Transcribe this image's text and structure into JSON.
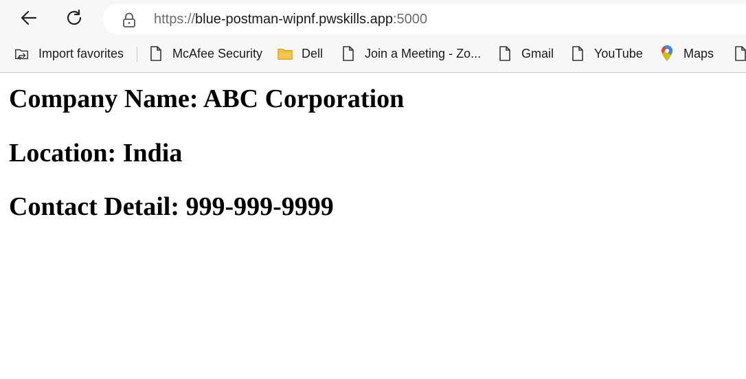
{
  "browser": {
    "url": {
      "scheme": "https://",
      "host": "blue-postman-wipnf.pwskills.app",
      "port": ":5000"
    }
  },
  "bookmarks": [
    {
      "label": "Import favorites",
      "icon": "import-favorites-icon"
    },
    {
      "label": "McAfee Security",
      "icon": "page-icon"
    },
    {
      "label": "Dell",
      "icon": "folder-icon"
    },
    {
      "label": "Join a Meeting - Zo...",
      "icon": "page-icon"
    },
    {
      "label": "Gmail",
      "icon": "page-icon"
    },
    {
      "label": "YouTube",
      "icon": "page-icon"
    },
    {
      "label": "Maps",
      "icon": "maps-pin-icon"
    }
  ],
  "content": {
    "company": "Company Name: ABC Corporation",
    "location": "Location: India",
    "contact": "Contact Detail: 999-999-9999"
  },
  "colors": {
    "chrome_bg": "#f7f7f7",
    "folder_yellow": "#f5c84c",
    "maps_red": "#ea4335",
    "maps_blue": "#4285f4",
    "maps_green": "#34a853",
    "maps_yellow": "#fbbc04"
  }
}
